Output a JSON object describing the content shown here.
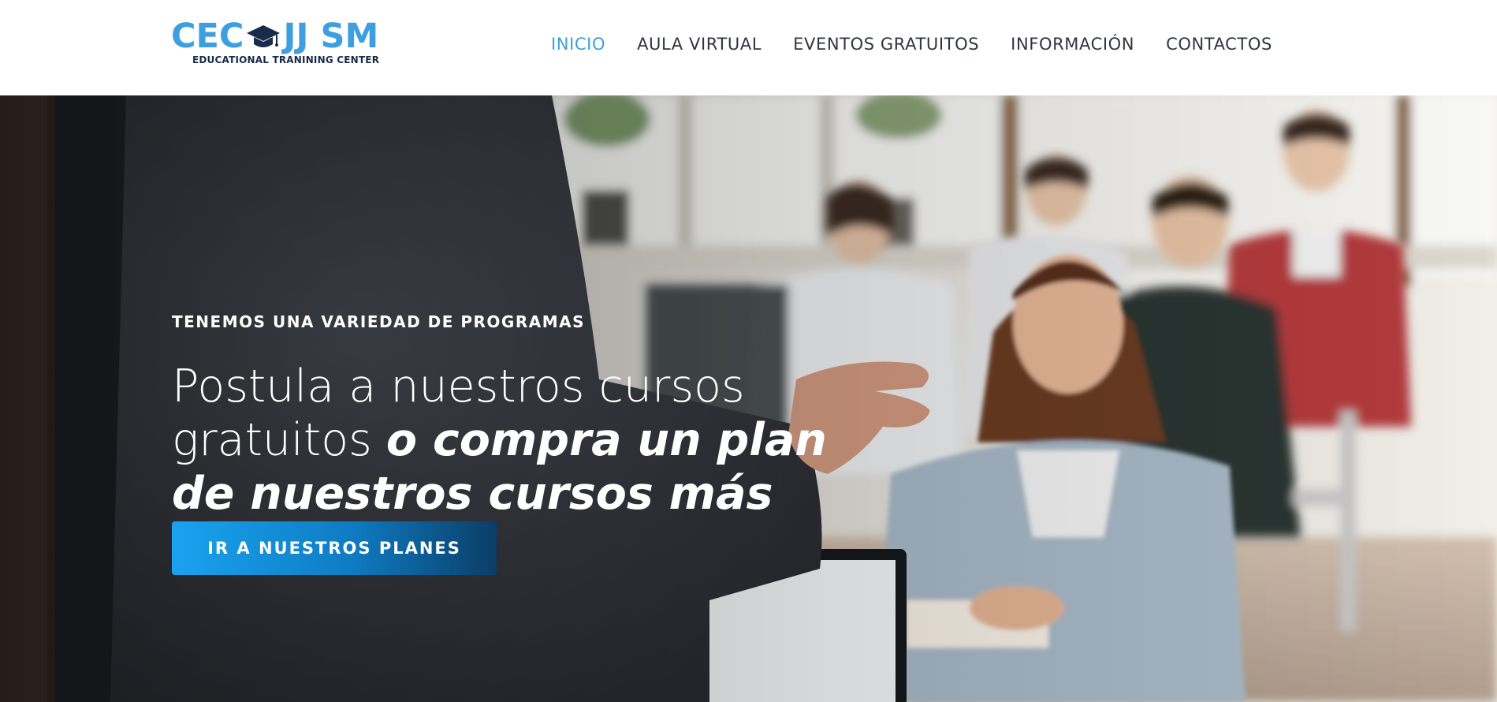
{
  "logo": {
    "text_left": "CEC",
    "text_right": "JJ SM",
    "tagline": "EDUCATIONAL TRANINING CENTER",
    "icon": "graduation-cap-icon",
    "brand_color": "#3d9fe0"
  },
  "nav": {
    "items": [
      {
        "label": "INICIO",
        "active": true
      },
      {
        "label": "AULA VIRTUAL",
        "active": false
      },
      {
        "label": "EVENTOS GRATUITOS",
        "active": false
      },
      {
        "label": "INFORMACIÓN",
        "active": false
      },
      {
        "label": "CONTACTOS",
        "active": false
      }
    ],
    "active_color": "#3d9fe0",
    "text_color": "#2f3640"
  },
  "hero": {
    "eyebrow": "TENEMOS UNA VARIEDAD DE PROGRAMAS",
    "headline_light": "Postula a nuestros cursos gratuitos ",
    "headline_bold": "o compra un plan de nuestros cursos más avanzados",
    "cta_label": "IR A NUESTROS PLANES"
  }
}
